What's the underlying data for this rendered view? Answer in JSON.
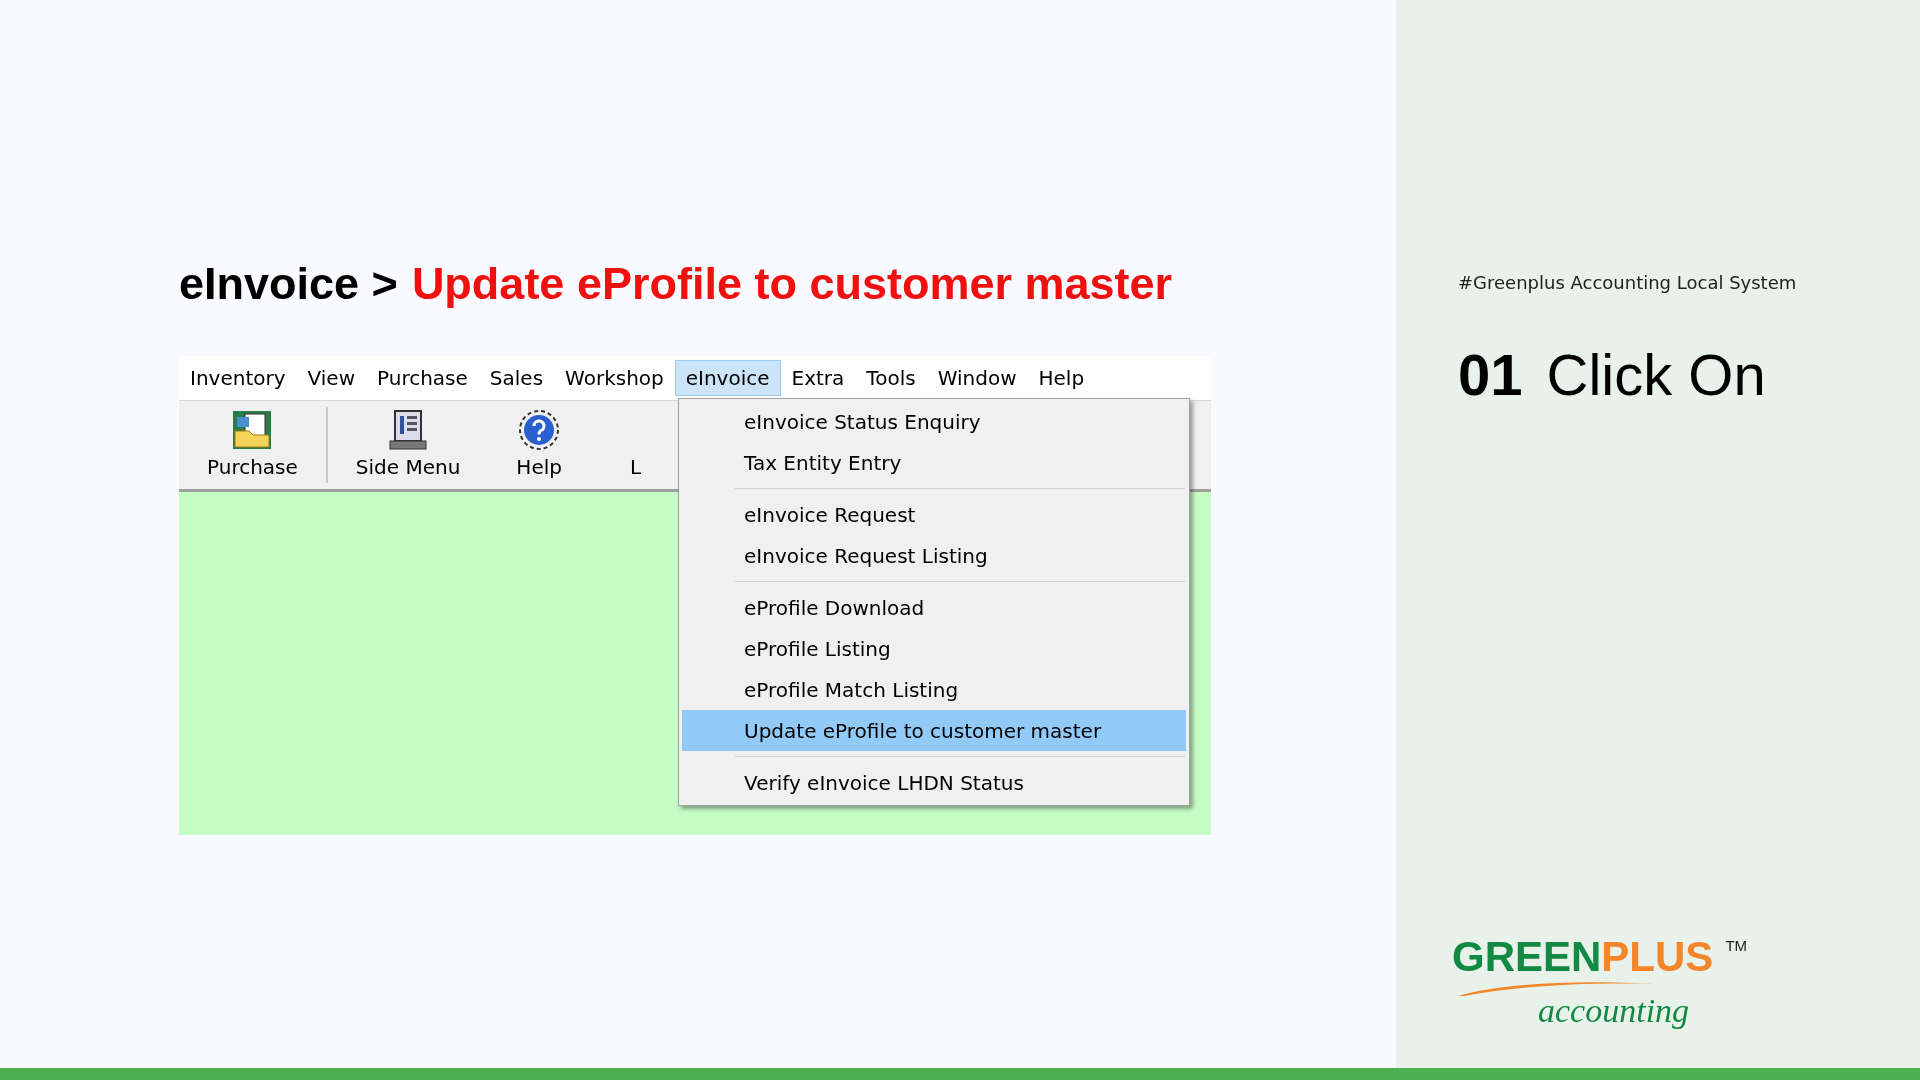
{
  "heading": {
    "path": "eInvoice >",
    "target": "Update eProfile to customer master"
  },
  "app": {
    "menubar": [
      {
        "label": "Inventory",
        "selected": false
      },
      {
        "label": "View",
        "selected": false
      },
      {
        "label": "Purchase",
        "selected": false
      },
      {
        "label": "Sales",
        "selected": false
      },
      {
        "label": "Workshop",
        "selected": false
      },
      {
        "label": "eInvoice",
        "selected": true
      },
      {
        "label": "Extra",
        "selected": false
      },
      {
        "label": "Tools",
        "selected": false
      },
      {
        "label": "Window",
        "selected": false
      },
      {
        "label": "Help",
        "selected": false
      }
    ],
    "toolbar": [
      {
        "label": "Purchase",
        "kind": "purchase"
      },
      {
        "label": "Side Menu",
        "kind": "sidemenu"
      },
      {
        "label": "Help",
        "kind": "help"
      },
      {
        "label": "L",
        "kind": "text"
      }
    ],
    "dropdown": [
      [
        {
          "label": "eInvoice Status Enquiry",
          "selected": false
        },
        {
          "label": "Tax Entity Entry",
          "selected": false
        }
      ],
      [
        {
          "label": "eInvoice Request",
          "selected": false
        },
        {
          "label": "eInvoice Request Listing",
          "selected": false
        }
      ],
      [
        {
          "label": "eProfile Download",
          "selected": false
        },
        {
          "label": "eProfile Listing",
          "selected": false
        },
        {
          "label": "eProfile Match Listing",
          "selected": false
        },
        {
          "label": "Update eProfile to customer master",
          "selected": true
        }
      ],
      [
        {
          "label": "Verify eInvoice LHDN Status",
          "selected": false
        }
      ]
    ]
  },
  "sidebar": {
    "hashtag": "#Greenplus Accounting Local System",
    "step_number": "01",
    "step_text": "Click On",
    "logo": {
      "green": "GREEN",
      "plus": "PLUS",
      "tm": "TM",
      "tagline": "accounting"
    }
  }
}
